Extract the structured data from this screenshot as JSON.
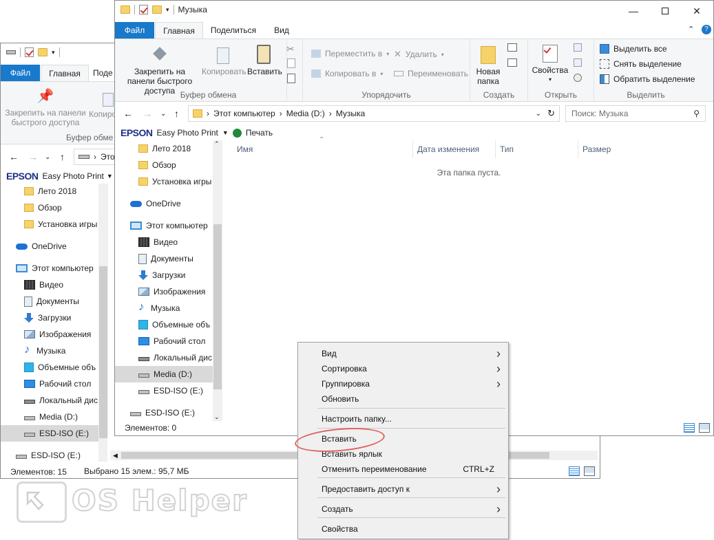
{
  "back_window": {
    "tabs": {
      "file": "Файл",
      "home": "Главная",
      "share": "Поде"
    },
    "ribbon": {
      "pin_label": "Закрепить на панели быстрого доступа",
      "copy_label": "Копиро",
      "clipboard_group": "Буфер обме"
    },
    "addr_path": "Это",
    "epson": {
      "logo": "EPSON",
      "app": "Easy Photo Print"
    },
    "nav": [
      {
        "label": "Лето 2018",
        "icon": "folder-icon"
      },
      {
        "label": "Обзор",
        "icon": "folder-icon"
      },
      {
        "label": "Установка игры",
        "icon": "folder-icon"
      },
      {
        "label": "OneDrive",
        "icon": "onedrive-icon"
      },
      {
        "label": "Этот компьютер",
        "icon": "computer-icon"
      },
      {
        "label": "Видео",
        "icon": "video-icon"
      },
      {
        "label": "Документы",
        "icon": "documents-icon"
      },
      {
        "label": "Загрузки",
        "icon": "downloads-icon"
      },
      {
        "label": "Изображения",
        "icon": "pictures-icon"
      },
      {
        "label": "Музыка",
        "icon": "music-icon"
      },
      {
        "label": "Объемные объ",
        "icon": "3d-objects-icon"
      },
      {
        "label": "Рабочий стол",
        "icon": "desktop-icon"
      },
      {
        "label": "Локальный дис",
        "icon": "local-disk-icon"
      },
      {
        "label": "Media (D:)",
        "icon": "drive-icon"
      },
      {
        "label": "ESD-ISO (E:)",
        "icon": "drive-icon"
      },
      {
        "label": "ESD-ISO (E:)",
        "icon": "drive-icon"
      }
    ],
    "status": {
      "items": "Элементов: 15",
      "selected": "Выбрано 15 элем.: 95,7 МБ"
    }
  },
  "front_window": {
    "title": "Музыка",
    "tabs": {
      "file": "Файл",
      "home": "Главная",
      "share": "Поделиться",
      "view": "Вид"
    },
    "ribbon": {
      "pin_label": "Закрепить на панели быстрого доступа",
      "copy_label": "Копировать",
      "paste_label": "Вставить",
      "clipboard_group": "Буфер обмена",
      "move_to": "Переместить в",
      "copy_to": "Копировать в",
      "delete": "Удалить",
      "rename": "Переименовать",
      "organize_group": "Упорядочить",
      "new_folder": "Новая папка",
      "new_group": "Создать",
      "properties": "Свойства",
      "open_group": "Открыть",
      "select_all": "Выделить все",
      "select_none": "Снять выделение",
      "invert_selection": "Обратить выделение",
      "select_group": "Выделить"
    },
    "address": {
      "crumbs": [
        "Этот компьютер",
        "Media (D:)",
        "Музыка"
      ],
      "search_placeholder": "Поиск: Музыка"
    },
    "epson": {
      "logo": "EPSON",
      "app": "Easy Photo Print",
      "print": "Печать"
    },
    "nav": [
      {
        "label": "Лето 2018",
        "icon": "folder-icon"
      },
      {
        "label": "Обзор",
        "icon": "folder-icon"
      },
      {
        "label": "Установка игры",
        "icon": "folder-icon"
      },
      {
        "label": "OneDrive",
        "icon": "onedrive-icon"
      },
      {
        "label": "Этот компьютер",
        "icon": "computer-icon"
      },
      {
        "label": "Видео",
        "icon": "video-icon"
      },
      {
        "label": "Документы",
        "icon": "documents-icon"
      },
      {
        "label": "Загрузки",
        "icon": "downloads-icon"
      },
      {
        "label": "Изображения",
        "icon": "pictures-icon"
      },
      {
        "label": "Музыка",
        "icon": "music-icon"
      },
      {
        "label": "Объемные объ",
        "icon": "3d-objects-icon"
      },
      {
        "label": "Рабочий стол",
        "icon": "desktop-icon"
      },
      {
        "label": "Локальный дис",
        "icon": "local-disk-icon"
      },
      {
        "label": "Media (D:)",
        "icon": "drive-icon"
      },
      {
        "label": "ESD-ISO (E:)",
        "icon": "drive-icon"
      },
      {
        "label": "ESD-ISO (E:)",
        "icon": "drive-icon"
      }
    ],
    "columns": [
      "Имя",
      "Дата изменения",
      "Тип",
      "Размер"
    ],
    "empty_text": "Эта папка пуста.",
    "status": {
      "items": "Элементов: 0"
    }
  },
  "context_menu": {
    "items": [
      {
        "label": "Вид",
        "submenu": true
      },
      {
        "label": "Сортировка",
        "submenu": true
      },
      {
        "label": "Группировка",
        "submenu": true
      },
      {
        "label": "Обновить"
      },
      {
        "label": "Настроить папку..."
      },
      {
        "label": "Вставить"
      },
      {
        "label": "Вставить ярлык"
      },
      {
        "label": "Отменить переименование",
        "shortcut": "CTRL+Z"
      },
      {
        "label": "Предоставить доступ к",
        "submenu": true
      },
      {
        "label": "Создать",
        "submenu": true
      },
      {
        "label": "Свойства"
      }
    ]
  },
  "watermark": {
    "text": "OS Helper"
  },
  "colors": {
    "file_tab": "#1979ca",
    "highlight_oval": "#e0625e",
    "epson_blue": "#1b2f83"
  }
}
